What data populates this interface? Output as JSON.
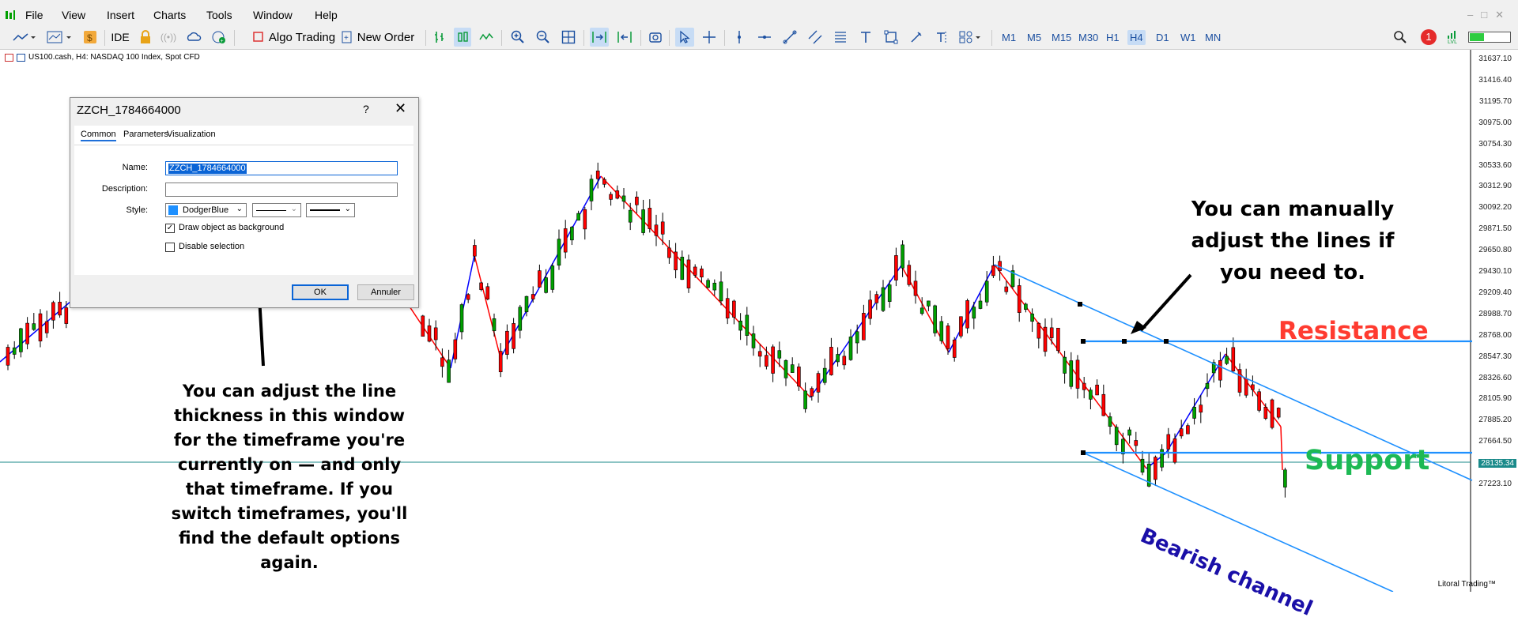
{
  "menu": {
    "items": [
      "File",
      "View",
      "Insert",
      "Charts",
      "Tools",
      "Window",
      "Help"
    ]
  },
  "toolbar": {
    "ide_label": "IDE",
    "algo_label": "Algo Trading",
    "new_order_label": "New Order",
    "timeframes": [
      "M1",
      "M5",
      "M15",
      "M30",
      "H1",
      "H4",
      "D1",
      "W1",
      "MN"
    ],
    "active_timeframe": "H4",
    "notification_count": "1",
    "lvl_label": "LVL"
  },
  "chart": {
    "label": "US100.cash, H4:  NASDAQ 100 Index, Spot CFD",
    "prices": [
      "31637.10",
      "31416.40",
      "31195.70",
      "30975.00",
      "30754.30",
      "30533.60",
      "30312.90",
      "30092.20",
      "29871.50",
      "29650.80",
      "29430.10",
      "29209.40",
      "28988.70",
      "28768.00",
      "28547.30",
      "28326.60",
      "28105.90",
      "27885.20",
      "27664.50",
      "27443.80",
      "27223.10"
    ],
    "current_price": "28135.34",
    "watermark": "Litoral Trading™",
    "colors": {
      "up": "#00a000",
      "down": "#ff0000",
      "zigzag_up": "#0000ff",
      "zigzag_down": "#ff0000",
      "channel": "#1e90ff"
    }
  },
  "dialog": {
    "title": "ZZCH_1784664000",
    "help": "?",
    "close": "✕",
    "tabs": [
      "Common",
      "Parameters",
      "Visualization"
    ],
    "name_label": "Name:",
    "name_value": "ZZCH_1784664000",
    "description_label": "Description:",
    "description_value": "",
    "style_label": "Style:",
    "color_value": "DodgerBlue",
    "color_hex": "#1e90ff",
    "draw_background_label": "Draw object as background",
    "draw_background_checked": true,
    "disable_selection_label": "Disable selection",
    "disable_selection_checked": false,
    "ok_label": "OK",
    "cancel_label": "Annuler"
  },
  "annotations": {
    "thickness_note": "You can adjust the line thickness in this window for the timeframe you're currently on — and only that timeframe. If you switch timeframes, you'll find the default options again.",
    "manual_note": "You can manually adjust the lines if you need to.",
    "resistance": "Resistance",
    "support": "Support",
    "bearish_channel": "Bearish channel",
    "resistance_color": "#ff3b30",
    "support_color": "#1db954",
    "channel_text_color": "#1a0fa8"
  }
}
